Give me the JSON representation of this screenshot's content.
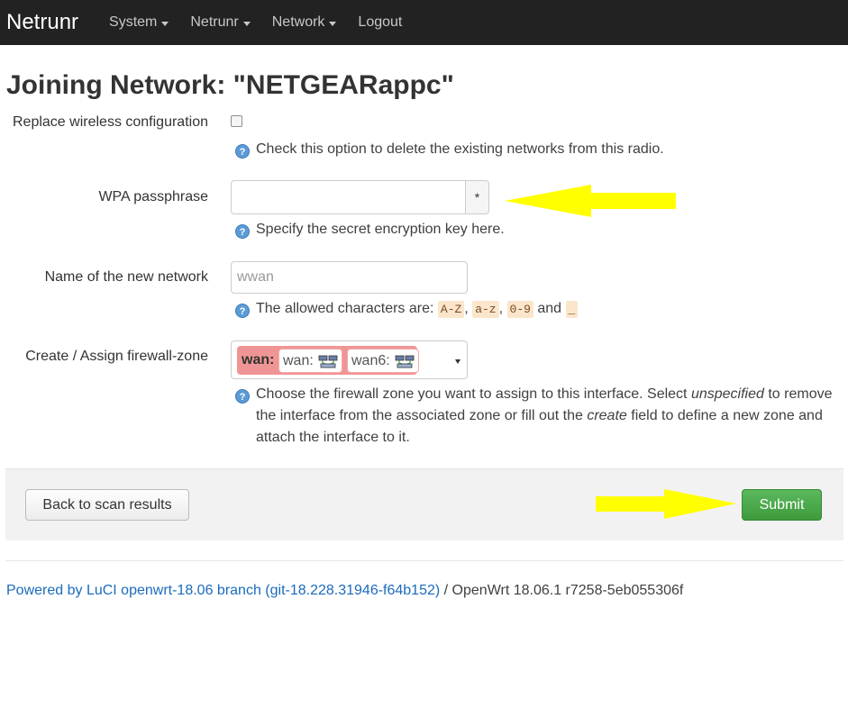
{
  "navbar": {
    "brand": "Netrunr",
    "menu": [
      {
        "label": "System",
        "dropdown": true
      },
      {
        "label": "Netrunr",
        "dropdown": true
      },
      {
        "label": "Network",
        "dropdown": true
      },
      {
        "label": "Logout",
        "dropdown": false
      }
    ]
  },
  "page": {
    "title": "Joining Network: \"NETGEARappc\""
  },
  "form": {
    "replace": {
      "label": "Replace wireless configuration",
      "checked": false,
      "help": "Check this option to delete the existing networks from this radio."
    },
    "wpa": {
      "label": "WPA passphrase",
      "value": "",
      "reveal_symbol": "*",
      "help": "Specify the secret encryption key here."
    },
    "network_name": {
      "label": "Name of the new network",
      "value": "wwan",
      "help_prefix": "The allowed characters are:",
      "codes": [
        "A-Z",
        "a-z",
        "0-9",
        "_"
      ],
      "sep1": ",",
      "sep2": ",",
      "sep3": "and"
    },
    "firewall": {
      "label": "Create / Assign firewall-zone",
      "zone": "wan:",
      "chips": [
        "wan:",
        "wan6:"
      ],
      "help_1": "Choose the firewall zone you want to assign to this interface. Select",
      "help_em1": "unspecified",
      "help_2": "to remove the interface from the associated zone or fill out the",
      "help_em2": "create",
      "help_3": "field to define a new zone and attach the interface to it."
    }
  },
  "actions": {
    "back_label": "Back to scan results",
    "submit_label": "Submit"
  },
  "footer": {
    "link": "Powered by LuCI openwrt-18.06 branch (git-18.228.31946-f64b152)",
    "rest": "/ OpenWrt 18.06.1 r7258-5eb055306f"
  },
  "colors": {
    "navbar_bg": "#222222",
    "zone_wan": "#f09595",
    "submit_green": "#4cae4c",
    "annotation_arrow": "#ffff00",
    "link": "#1a6bbd"
  },
  "icons": {
    "help": "help-circle-icon",
    "network": "network-ports-icon",
    "annotation": "arrow-annotation"
  }
}
